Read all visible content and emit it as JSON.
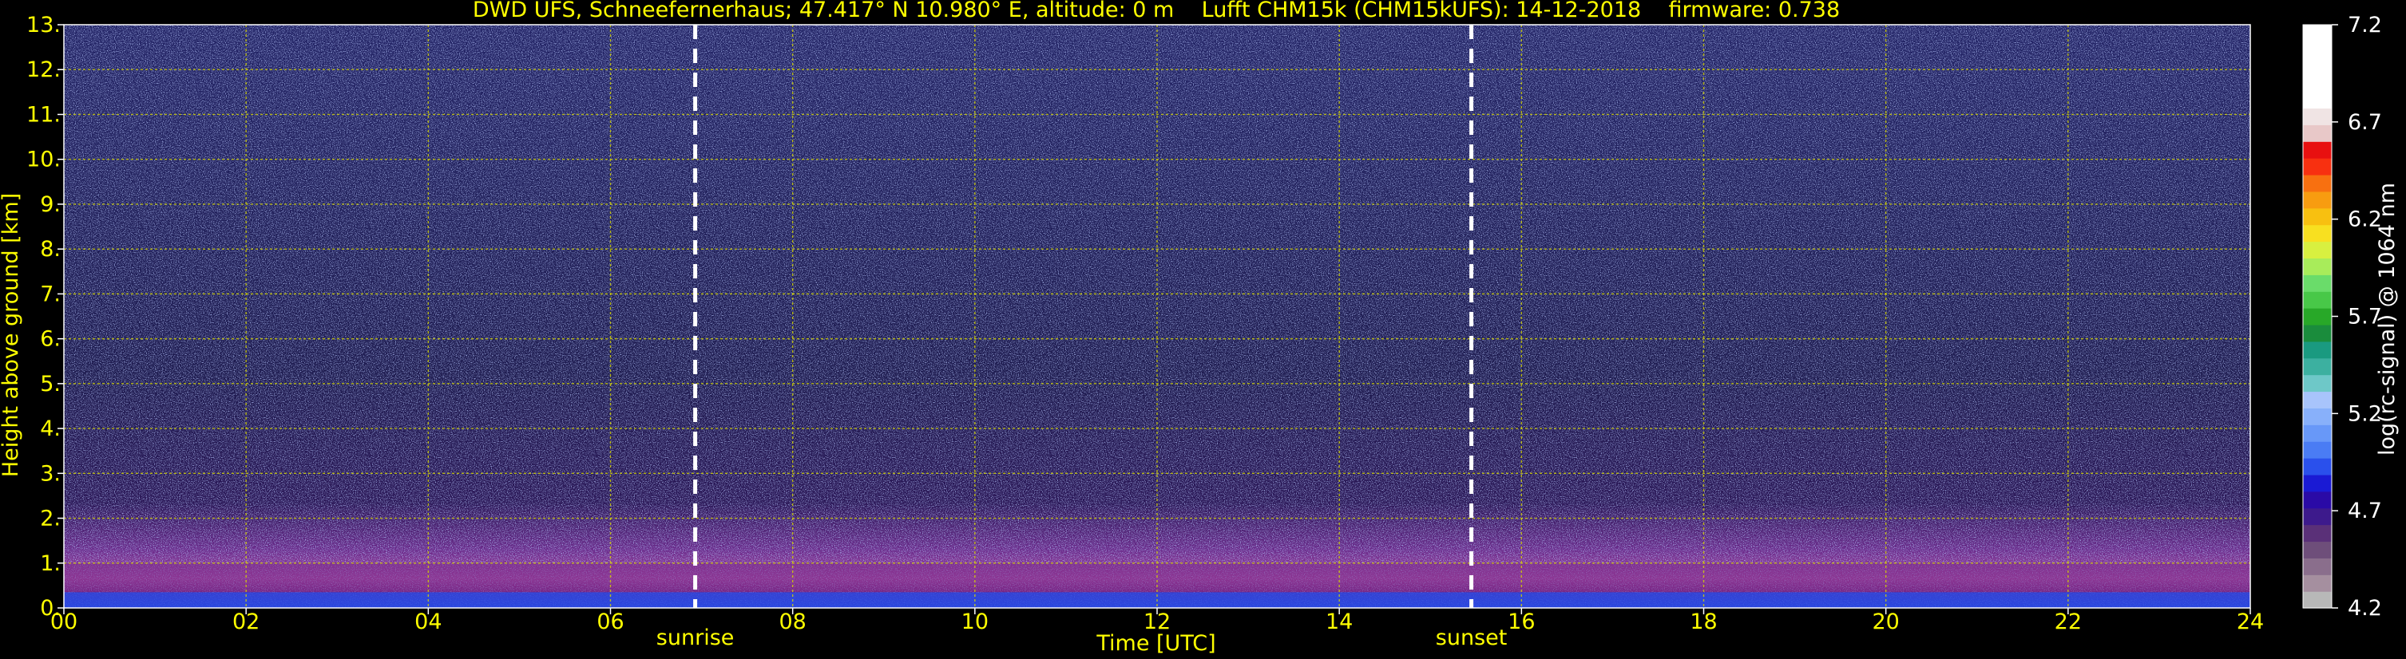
{
  "chart_data": {
    "type": "heatmap",
    "title": "DWD UFS, Schneefernerhaus; 47.417° N 10.980° E, altitude: 0 m    Lufft CHM15k (CHM15kUFS): 14-12-2018    firmware: 0.738",
    "xlabel": "Time [UTC]",
    "ylabel": "Height above ground [km]",
    "xlim": [
      0,
      24
    ],
    "ylim": [
      0,
      13
    ],
    "xticks": [
      "00",
      "02",
      "04",
      "06",
      "08",
      "10",
      "12",
      "14",
      "16",
      "18",
      "20",
      "22",
      "24"
    ],
    "yticks": [
      "0.",
      "1.",
      "2.",
      "3.",
      "4.",
      "5.",
      "6.",
      "7.",
      "8.",
      "9.",
      "10.",
      "11.",
      "12.",
      "13."
    ],
    "grid": true,
    "colorbar": {
      "label": "log(rc-signal) @ 1064 nm",
      "range": [
        4.2,
        7.2
      ],
      "ticks": [
        "4.2",
        "4.7",
        "5.2",
        "5.7",
        "6.2",
        "6.7",
        "7.2"
      ],
      "colors": [
        "#b8b8b8",
        "#a58f9f",
        "#8a6e8c",
        "#6e4e7a",
        "#5a3078",
        "#3d1a8c",
        "#2a0aa6",
        "#1a1ad4",
        "#2a50ec",
        "#4a7cf4",
        "#6898f8",
        "#88b0fa",
        "#a8c4fb",
        "#6ec8c8",
        "#3cb0a0",
        "#1a9a80",
        "#1a8c3c",
        "#28a828",
        "#48c848",
        "#6adc6a",
        "#a8ec5a",
        "#d8f040",
        "#f8e020",
        "#f8c010",
        "#f89c10",
        "#f87010",
        "#f83010",
        "#e81010",
        "#e8c8c8",
        "#f0e4e4",
        "#ffffff",
        "#ffffff",
        "#ffffff",
        "#ffffff",
        "#ffffff"
      ]
    },
    "markers": [
      {
        "label": "sunrise",
        "time": 6.93
      },
      {
        "label": "sunset",
        "time": 15.45
      }
    ],
    "profile": [
      {
        "height": 0.0,
        "level": "blue"
      },
      {
        "height": 0.35,
        "level": "purple"
      },
      {
        "height": 1.0,
        "level": "magenta"
      },
      {
        "height": 2.5,
        "level": "dark-purple-noise"
      },
      {
        "height": 13.0,
        "level": "sparse-noise"
      }
    ]
  },
  "colors": {
    "text": "#ffff00",
    "axis": "#ffffff",
    "grid": "#d6d600",
    "cbar_label": "#ffffff"
  }
}
